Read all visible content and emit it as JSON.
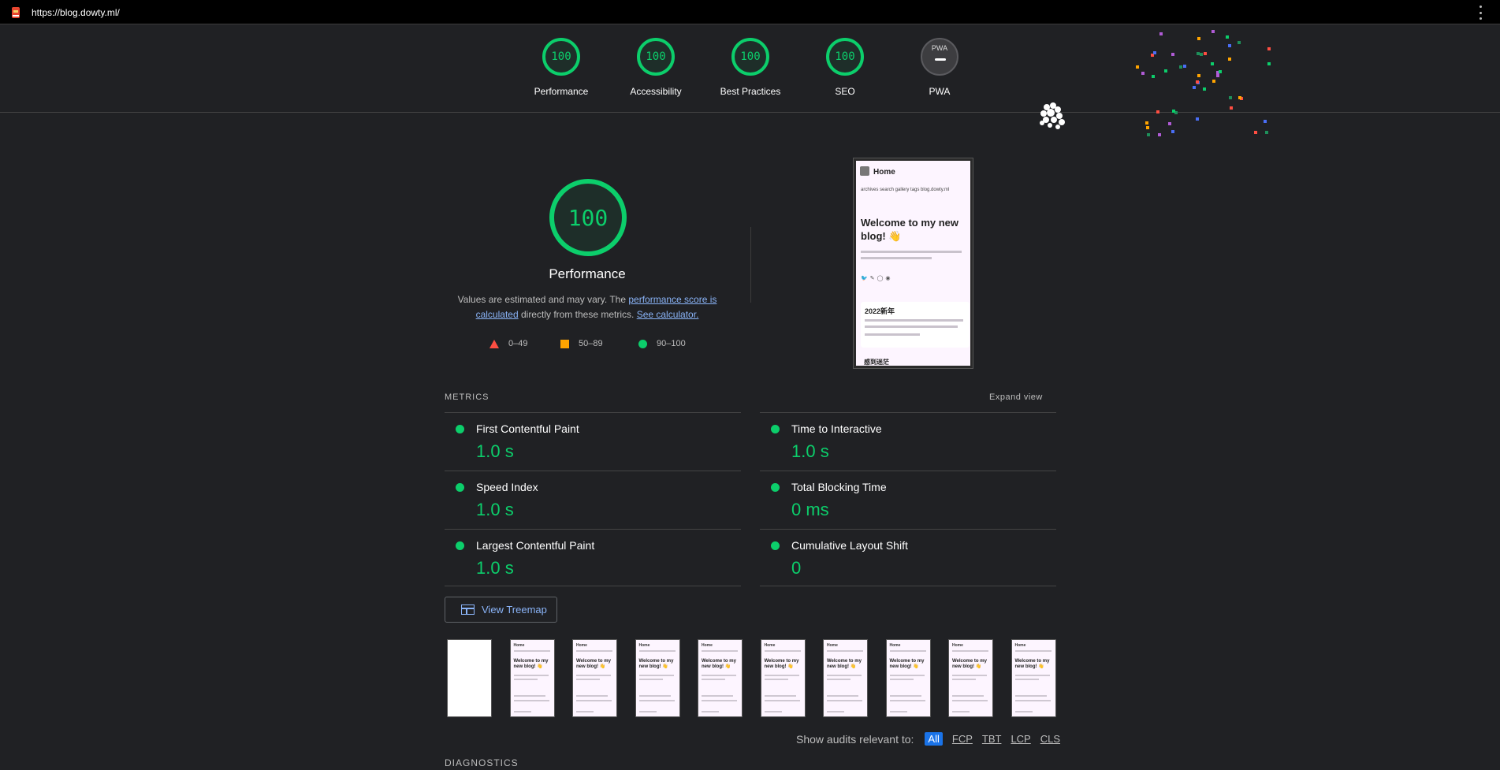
{
  "browser": {
    "url": "https://blog.dowty.ml/",
    "favicon": "lighthouse-icon"
  },
  "header_gauges": [
    {
      "label": "Performance",
      "score": "100"
    },
    {
      "label": "Accessibility",
      "score": "100"
    },
    {
      "label": "Best Practices",
      "score": "100"
    },
    {
      "label": "SEO",
      "score": "100"
    },
    {
      "label": "PWA",
      "score": "PWA"
    }
  ],
  "performance": {
    "score": "100",
    "title": "Performance",
    "desc_prefix": "Values are estimated and may vary. The ",
    "desc_link1": "performance score is calculated",
    "desc_middle": " directly from these metrics. ",
    "desc_link2": "See calculator.",
    "legend": [
      {
        "shape": "triangle",
        "range": "0–49",
        "color": "#ff4e42"
      },
      {
        "shape": "square",
        "range": "50–89",
        "color": "#ffa400"
      },
      {
        "shape": "circle",
        "range": "90–100",
        "color": "#0cce6b"
      }
    ]
  },
  "final_screenshot": {
    "home": "Home",
    "nav": "archives   search   gallery   tags   blog.dowty.ml",
    "heading": "Welcome to my new blog! 👋",
    "card_title": "2022新年",
    "bottom_title": "感到迷茫"
  },
  "metrics": {
    "section_label": "METRICS",
    "expand_label": "Expand view",
    "items": [
      {
        "title": "First Contentful Paint",
        "value": "1.0 s"
      },
      {
        "title": "Time to Interactive",
        "value": "1.0 s"
      },
      {
        "title": "Speed Index",
        "value": "1.0 s"
      },
      {
        "title": "Total Blocking Time",
        "value": "0 ms"
      },
      {
        "title": "Largest Contentful Paint",
        "value": "1.0 s"
      },
      {
        "title": "Cumulative Layout Shift",
        "value": "0"
      }
    ]
  },
  "treemap_label": "View Treemap",
  "filmstrip": {
    "frame_home": "Home",
    "frame_heading": "Welcome to my new blog! 👋"
  },
  "audits_filter": {
    "label": "Show audits relevant to:",
    "chips": [
      "All",
      "FCP",
      "TBT",
      "LCP",
      "CLS"
    ]
  },
  "diagnostics_label": "DIAGNOSTICS",
  "colors": {
    "pass": "#0cce6b",
    "average": "#ffa400",
    "fail": "#ff4e42",
    "link": "#8ab4f8",
    "background": "#202124"
  }
}
